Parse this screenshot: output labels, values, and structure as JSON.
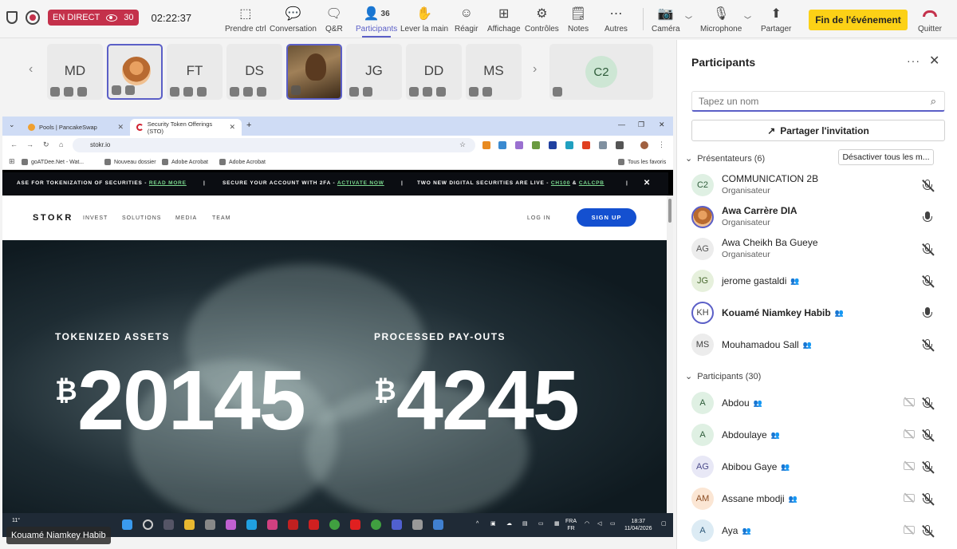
{
  "toolbar": {
    "live_label": "EN DIRECT",
    "viewers": "30",
    "timer": "02:22:37",
    "buttons": {
      "take_control": "Prendre ctrl",
      "chat": "Conversation",
      "qa": "Q&R",
      "participants": "Participants",
      "participants_count": "36",
      "raise_hand": "Lever la main",
      "react": "Réagir",
      "view": "Affichage",
      "controls": "Contrôles",
      "notes": "Notes",
      "more": "Autres",
      "camera": "Caméra",
      "microphone": "Microphone",
      "share": "Partager",
      "end_event": "Fin de l'événement",
      "leave": "Quitter"
    }
  },
  "strip": {
    "tiles": [
      {
        "initials": "MD"
      },
      {
        "initials": ""
      },
      {
        "initials": "FT"
      },
      {
        "initials": "DS"
      },
      {
        "initials": ""
      },
      {
        "initials": "JG"
      },
      {
        "initials": "DD"
      },
      {
        "initials": "MS"
      }
    ],
    "featured": "C2"
  },
  "browser": {
    "tabs": [
      {
        "title": "Pools | PancakeSwap"
      },
      {
        "title": "Security Token Offerings (STO)"
      }
    ],
    "url": "stokr.io",
    "bookmarks": [
      "goATDee.Net - Wat...",
      "Nouveau dossier",
      "Adobe Acrobat",
      "Adobe Acrobat"
    ],
    "all_bookmarks": "Tous les favoris"
  },
  "site": {
    "banner": {
      "item1": "ASE FOR TOKENIZATION OF SECURITIES -",
      "item1_link": "READ MORE",
      "item2": "SECURE YOUR ACCOUNT WITH 2FA -",
      "item2_link": "ACTIVATE NOW",
      "item3": "TWO NEW DIGITAL SECURITIES ARE LIVE -",
      "item3_link1": "CH100",
      "amp": "&",
      "item3_link2": "CALCPB",
      "close": "✕"
    },
    "logo": "STOKR",
    "nav": [
      "INVEST",
      "SOLUTIONS",
      "MEDIA",
      "TEAM"
    ],
    "login": "LOG IN",
    "signup": "SIGN UP",
    "stat1_label": "TOKENIZED ASSETS",
    "stat1_value": "20145",
    "stat2_label": "PROCESSED PAY-OUTS",
    "stat2_value": "4245",
    "currency": "₿"
  },
  "taskbar": {
    "weather": "11°",
    "lang1": "FRA",
    "lang2": "FR",
    "time": "18:37",
    "date": "11/04/2026"
  },
  "presenter_name": "Kouamé Niamkey Habib",
  "panel": {
    "title": "Participants",
    "search_placeholder": "Tapez un nom",
    "share_invite": "Partager l'invitation",
    "presenters_head": "Présentateurs (6)",
    "mute_all": "Désactiver tous les m...",
    "participants_head": "Participants (30)",
    "presenters": [
      {
        "initials": "C2",
        "name": "COMMUNICATION 2B",
        "role": "Organisateur"
      },
      {
        "initials": "",
        "name": "Awa Carrère DIA",
        "role": "Organisateur"
      },
      {
        "initials": "AG",
        "name": "Awa Cheikh Ba Gueye",
        "role": "Organisateur"
      },
      {
        "initials": "JG",
        "name": "jerome gastaldi",
        "role": ""
      },
      {
        "initials": "KH",
        "name": "Kouamé Niamkey Habib",
        "role": ""
      },
      {
        "initials": "MS",
        "name": "Mouhamadou Sall",
        "role": ""
      }
    ],
    "attendees": [
      {
        "initials": "A",
        "name": "Abdou"
      },
      {
        "initials": "A",
        "name": "Abdoulaye"
      },
      {
        "initials": "AG",
        "name": "Abibou Gaye"
      },
      {
        "initials": "AM",
        "name": "Assane mbodji"
      },
      {
        "initials": "A",
        "name": "Aya"
      }
    ]
  },
  "colors": {
    "accent": "#5b5fc7",
    "live_red": "#c4314b",
    "end_yellow": "#fcd116",
    "signup_blue": "#1450d0"
  }
}
